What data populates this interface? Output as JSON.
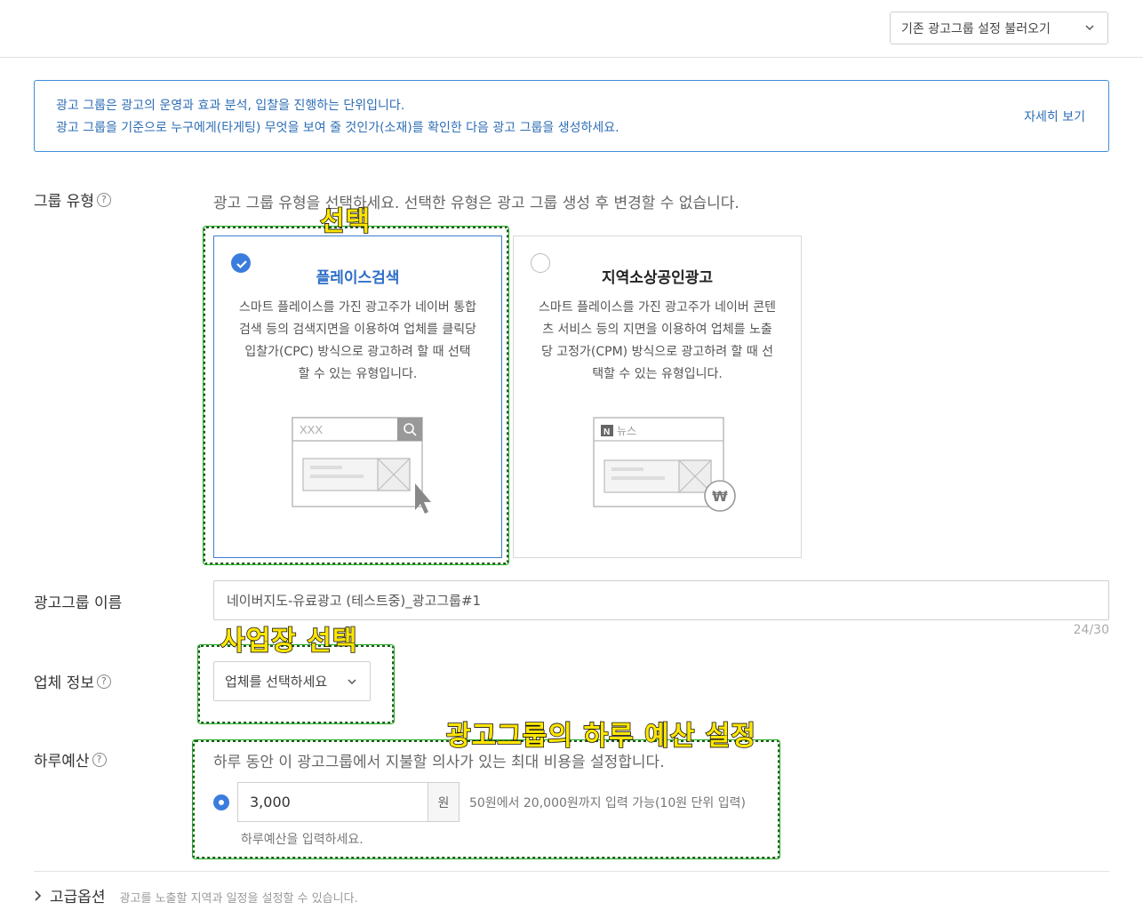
{
  "header": {
    "load_button_label": "기존 광고그룹 설정 불러오기"
  },
  "info": {
    "line1": "광고 그룹은 광고의 운영과 효과 분석, 입찰을 진행하는 단위입니다.",
    "line2": "광고 그룹을 기준으로 누구에게(타게팅) 무엇을 보여 줄 것인가(소재)를 확인한 다음 광고 그룹을 생성하세요.",
    "detail_link": "자세히 보기"
  },
  "group_type": {
    "label": "그룹 유형",
    "description": "광고 그룹 유형을 선택하세요. 선택한 유형은 광고 그룹 생성 후 변경할 수 없습니다.",
    "options": [
      {
        "title": "플레이스검색",
        "selected": true,
        "description": "스마트 플레이스를 가진 광고주가 네이버 통합검색 등의 검색지면을 이용하여 업체를 클릭당 입찰가(CPC) 방식으로 광고하려 할 때 선택할 수 있는 유형입니다.",
        "illustration_text": "XXX"
      },
      {
        "title": "지역소상공인광고",
        "selected": false,
        "description": "스마트 플레이스를 가진 광고주가 네이버 콘텐츠 서비스 등의 지면을 이용하여 업체를 노출당 고정가(CPM) 방식으로 광고하려 할 때 선택할 수 있는 유형입니다.",
        "illustration_text": "뉴스",
        "illustration_badge": "N",
        "currency_symbol": "₩"
      }
    ]
  },
  "group_name": {
    "label": "광고그룹 이름",
    "value": "네이버지도-유료광고 (테스트중)_광고그룹#1",
    "counter": "24/30"
  },
  "business": {
    "label": "업체 정보",
    "select_value": "업체를 선택하세요"
  },
  "daily_budget": {
    "label": "하루예산",
    "description": "하루 동안 이 광고그룹에서 지불할 의사가 있는 최대 비용을 설정합니다.",
    "value": "3,000",
    "unit": "원",
    "hint": "50원에서 20,000원까지 입력 가능(10원 단위 입력)",
    "sub_hint": "하루예산을 입력하세요."
  },
  "advanced": {
    "title": "고급옵션",
    "description": "광고를 노출할 지역과 일정을 설정할 수 있습니다."
  },
  "annotations": {
    "select": "선택",
    "business_select": "사업장 선택",
    "budget_setting": "광고그룹의 하루 예산 설정"
  },
  "colors": {
    "accent": "#3b7ddd",
    "annotation_text": "#ffe600",
    "annotation_border": "#1c5a1c"
  }
}
